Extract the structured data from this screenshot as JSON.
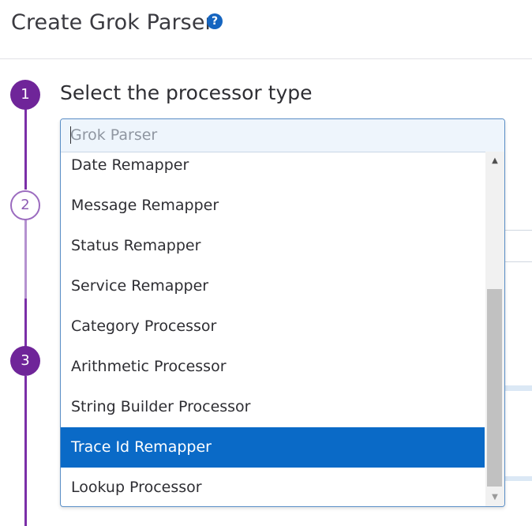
{
  "header": {
    "title": "Create Grok Parser",
    "help_icon": "?"
  },
  "steps": [
    {
      "number": "1",
      "title": "Select the processor type"
    },
    {
      "number": "2"
    },
    {
      "number": "3"
    }
  ],
  "processor_select": {
    "placeholder": "Grok Parser",
    "value": "",
    "options": [
      "Date Remapper",
      "Message Remapper",
      "Status Remapper",
      "Service Remapper",
      "Category Processor",
      "Arithmetic Processor",
      "String Builder Processor",
      "Trace Id Remapper",
      "Lookup Processor"
    ],
    "highlighted_option": "Trace Id Remapper"
  },
  "colors": {
    "accent": "#6f2599",
    "highlight": "#0a6ac7",
    "help": "#1565c0"
  }
}
